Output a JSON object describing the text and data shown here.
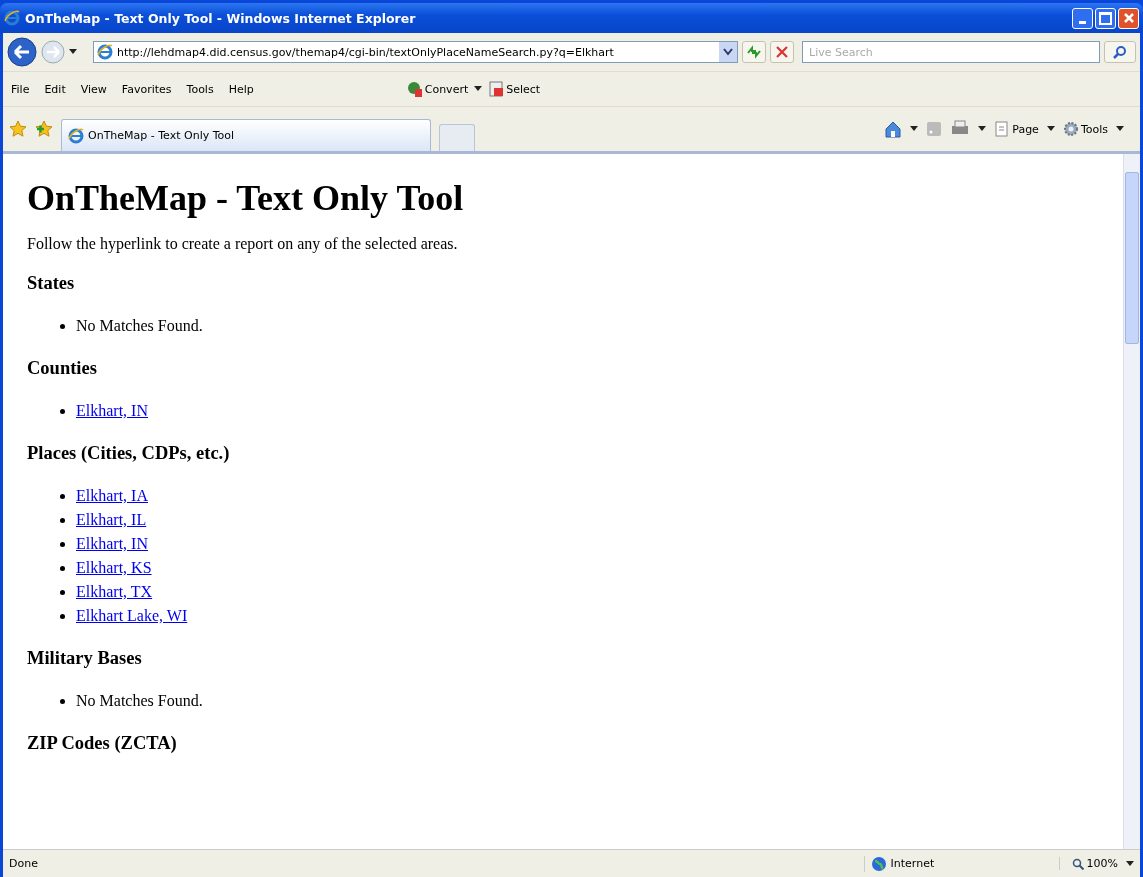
{
  "window": {
    "title": "OnTheMap - Text Only Tool - Windows Internet Explorer"
  },
  "address_bar": {
    "url": "http://lehdmap4.did.census.gov/themap4/cgi-bin/textOnlyPlaceNameSearch.py?q=Elkhart"
  },
  "search": {
    "placeholder": "Live Search"
  },
  "menu": [
    "File",
    "Edit",
    "View",
    "Favorites",
    "Tools",
    "Help"
  ],
  "addons": [
    "Convert",
    "Select"
  ],
  "tabs": [
    {
      "label": "OnTheMap - Text Only Tool",
      "selected": true
    }
  ],
  "command_bar": [
    "Page",
    "Tools"
  ],
  "page": {
    "title": "OnTheMap - Text Only Tool",
    "intro": "Follow the hyperlink to create a report on any of the selected areas.",
    "sections": [
      {
        "heading": "States",
        "items": [
          {
            "kind": "text",
            "text": "No Matches Found."
          }
        ]
      },
      {
        "heading": "Counties",
        "items": [
          {
            "kind": "link",
            "text": "Elkhart, IN"
          }
        ]
      },
      {
        "heading": "Places (Cities, CDPs, etc.)",
        "items": [
          {
            "kind": "link",
            "text": "Elkhart, IA"
          },
          {
            "kind": "link",
            "text": "Elkhart, IL"
          },
          {
            "kind": "link",
            "text": "Elkhart, IN"
          },
          {
            "kind": "link",
            "text": "Elkhart, KS"
          },
          {
            "kind": "link",
            "text": "Elkhart, TX"
          },
          {
            "kind": "link",
            "text": "Elkhart Lake, WI"
          }
        ]
      },
      {
        "heading": "Military Bases",
        "items": [
          {
            "kind": "text",
            "text": "No Matches Found."
          }
        ]
      },
      {
        "heading": "ZIP Codes (ZCTA)"
      }
    ]
  },
  "status_bar": {
    "status": "Done",
    "zone": "Internet",
    "zoom": "100%"
  }
}
